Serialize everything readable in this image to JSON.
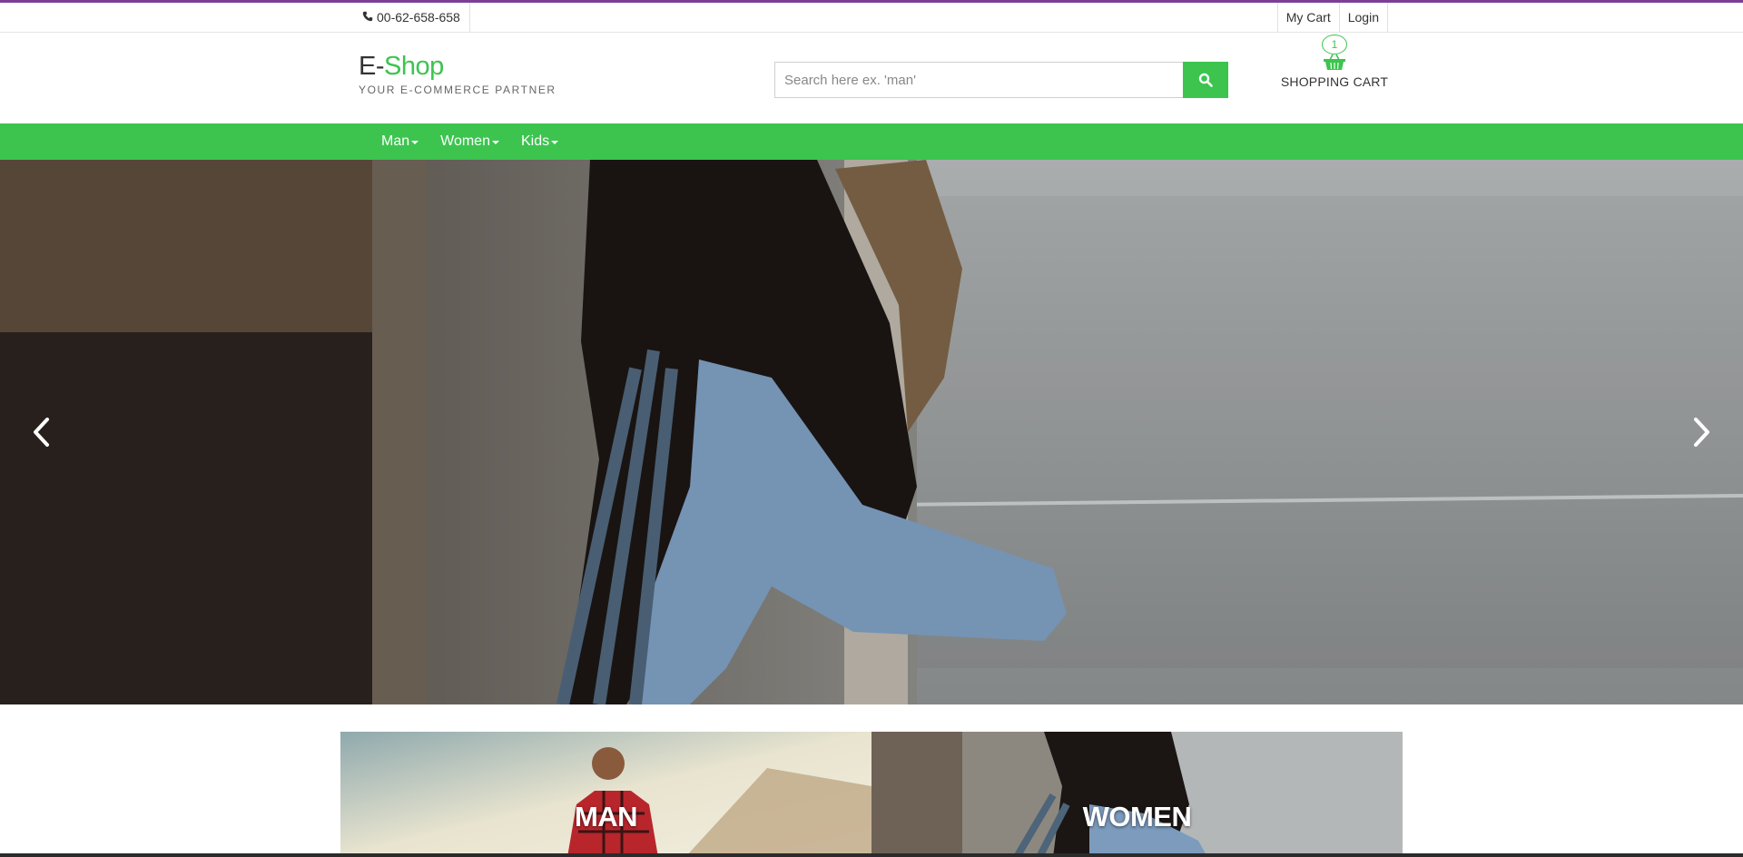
{
  "topbar": {
    "phone_icon": "phone-icon",
    "phone": "00-62-658-658",
    "links": [
      "My Cart",
      "Login"
    ]
  },
  "header": {
    "logo_prefix": "E-",
    "logo_main": "Shop",
    "tagline": "YOUR E-COMMERCE PARTNER",
    "search_placeholder": "Search here ex. 'man'",
    "search_value": "",
    "search_icon": "search-icon",
    "cart_count": "1",
    "cart_icon": "basket-icon",
    "cart_label": "SHOPPING CART"
  },
  "nav": {
    "items": [
      "Man",
      "Women",
      "Kids"
    ]
  },
  "hero": {
    "prev_icon": "chevron-left-icon",
    "next_icon": "chevron-right-icon"
  },
  "categories": {
    "items": [
      "MAN",
      "WOMEN"
    ]
  },
  "colors": {
    "accent": "#3cc44f",
    "top_line": "#7b3f98"
  }
}
